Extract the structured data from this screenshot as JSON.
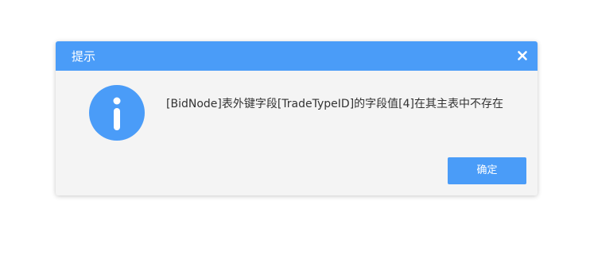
{
  "dialog": {
    "title": "提示",
    "close_icon": "close-icon",
    "icon": "info-icon",
    "message": "[BidNode]表外键字段[TradeTypeID]的字段值[4]在其主表中不存在",
    "ok_label": "确定"
  },
  "colors": {
    "accent": "#4a9cf8",
    "dialog_bg": "#f4f4f4",
    "text": "#333333"
  }
}
